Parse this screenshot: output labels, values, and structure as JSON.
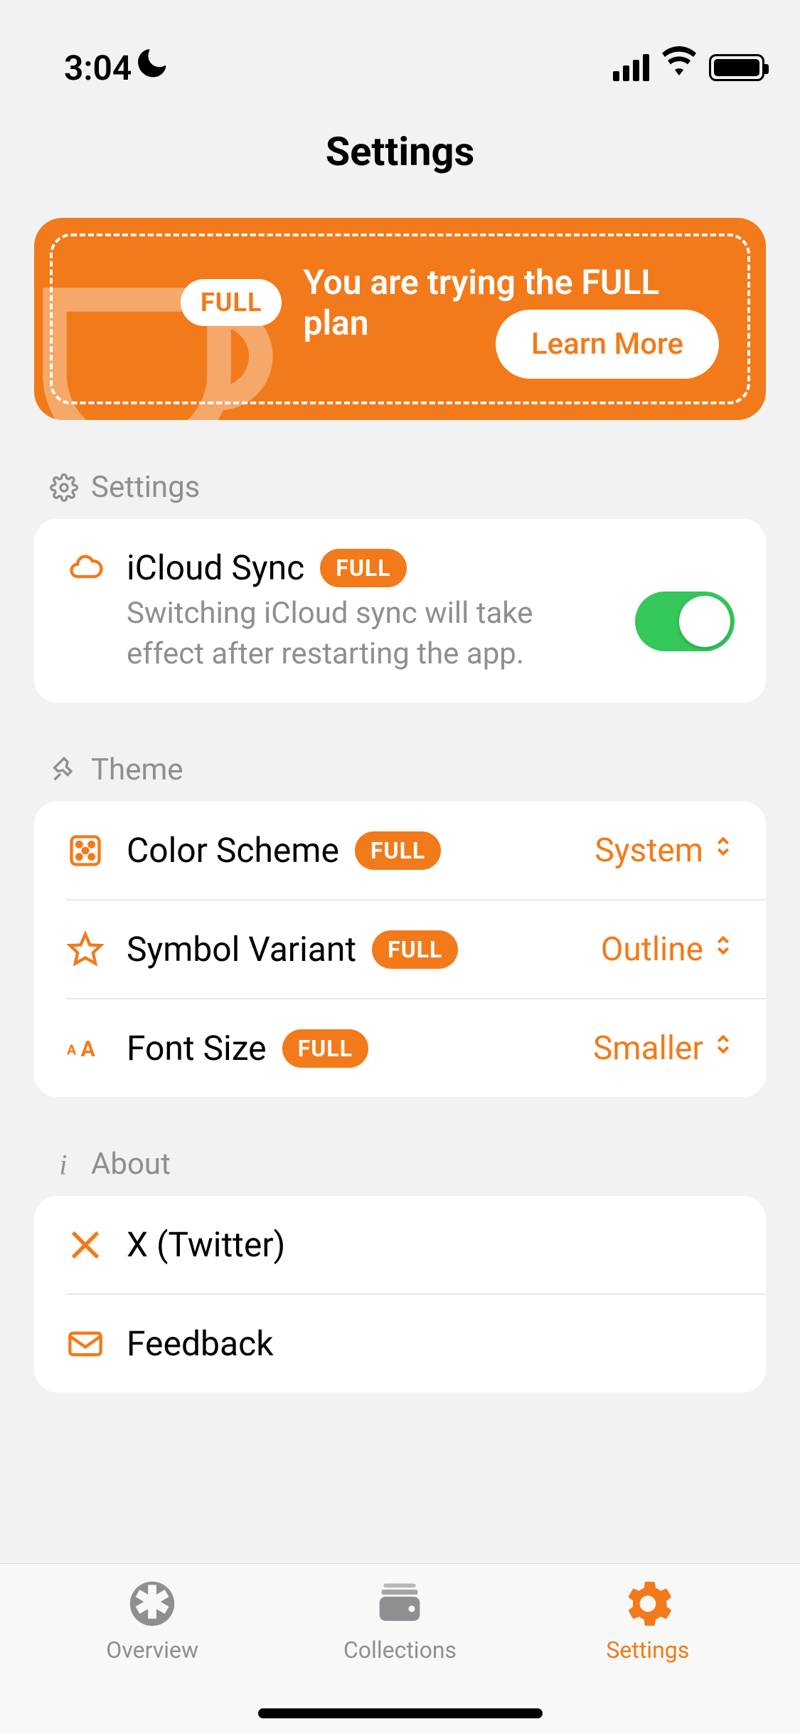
{
  "status": {
    "time": "3:04",
    "moon_icon": "moon-icon"
  },
  "header": {
    "title": "Settings"
  },
  "promo": {
    "badge": "FULL",
    "text": "You are trying the FULL plan",
    "learn_more": "Learn More"
  },
  "sections": {
    "settings": {
      "label": "Settings",
      "icloud": {
        "title": "iCloud Sync",
        "badge": "FULL",
        "subtitle": "Switching iCloud sync will take effect after restarting the app.",
        "toggle_on": true
      }
    },
    "theme": {
      "label": "Theme",
      "rows": {
        "color_scheme": {
          "title": "Color Scheme",
          "badge": "FULL",
          "value": "System"
        },
        "symbol_variant": {
          "title": "Symbol Variant",
          "badge": "FULL",
          "value": "Outline"
        },
        "font_size": {
          "title": "Font Size",
          "badge": "FULL",
          "value": "Smaller"
        }
      }
    },
    "about": {
      "label": "About",
      "rows": {
        "twitter": {
          "title": "X (Twitter)"
        },
        "feedback": {
          "title": "Feedback"
        }
      }
    }
  },
  "tabs": {
    "overview": "Overview",
    "collections": "Collections",
    "settings": "Settings"
  },
  "colors": {
    "accent": "#f27a1a",
    "toggle_on": "#34c759",
    "secondary_text": "#8e8e93"
  }
}
